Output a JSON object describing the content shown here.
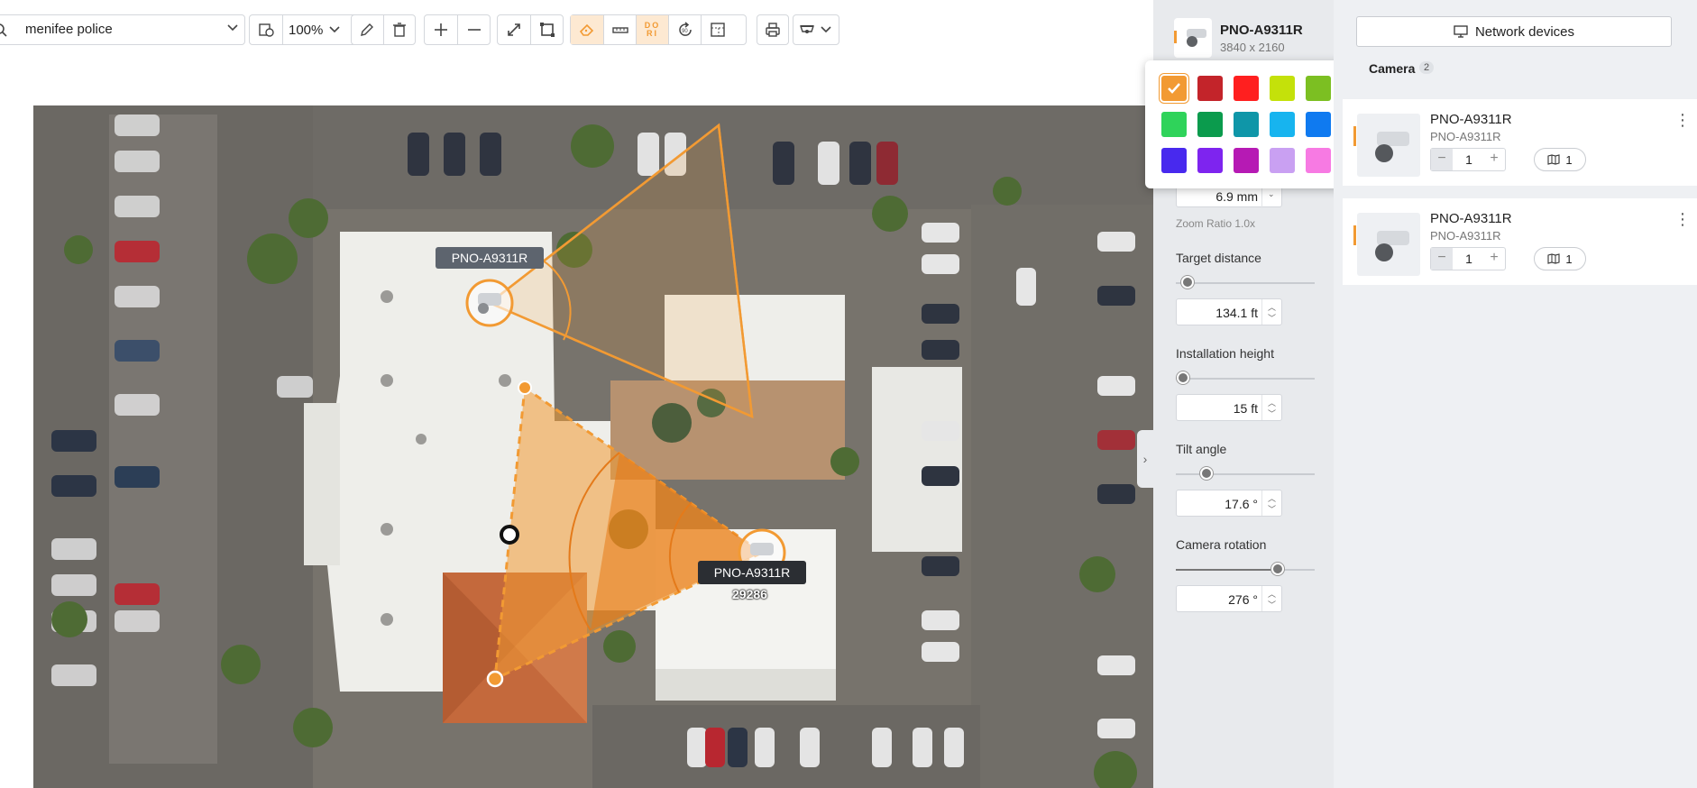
{
  "toolbar": {
    "search_value": "menifee police",
    "zoom_value": "100%",
    "tools": [
      "layers-icon",
      "pencil-icon",
      "trash-icon",
      "zoom-in-icon",
      "zoom-out-icon",
      "measure-line-icon",
      "crop-frame-icon",
      "eraser-icon",
      "ruler-icon",
      "dori-icon",
      "rotate-90-icon",
      "blueprint-icon",
      "print-icon",
      "camera-mount-icon"
    ],
    "dori_label": "DO RI"
  },
  "map": {
    "camera_label_1": "PNO-A9311R",
    "camera_label_2": "PNO-A9311R",
    "sub_label": "29286"
  },
  "side_panel": {
    "camera_title": "PNO-A9311R",
    "resolution": "3840 x 2160",
    "focal_length": "6.9 mm",
    "zoom_ratio": "Zoom Ratio 1.0x",
    "target_distance_label": "Target distance",
    "target_distance_value": "134.1 ft",
    "installation_height_label": "Installation height",
    "installation_height_value": "15 ft",
    "tilt_angle_label": "Tilt angle",
    "tilt_angle_value": "17.6 °",
    "camera_rotation_label": "Camera rotation",
    "camera_rotation_value": "276 °",
    "target_distance_fraction": 0.05,
    "installation_height_fraction": 0.02,
    "tilt_angle_fraction": 0.19,
    "camera_rotation_fraction": 0.77
  },
  "color_palette": {
    "selected": "#f29a33",
    "colors": [
      "#f29a33",
      "#c3242a",
      "#ff1f1f",
      "#c4e10a",
      "#7cbf22",
      "#2fd35a",
      "#0b9b4d",
      "#0f96a8",
      "#17b4ef",
      "#0f7af0",
      "#4829ee",
      "#7e24ef",
      "#b61ab4",
      "#c9a0f2",
      "#f77ae3"
    ]
  },
  "right_panel": {
    "network_button": "Network devices",
    "tab_label": "Camera",
    "tab_count": "2",
    "cards": [
      {
        "name": "PNO-A9311R",
        "model": "PNO-A9311R",
        "qty": "1",
        "map_count": "1"
      },
      {
        "name": "PNO-A9311R",
        "model": "PNO-A9311R",
        "qty": "1",
        "map_count": "1"
      }
    ]
  }
}
